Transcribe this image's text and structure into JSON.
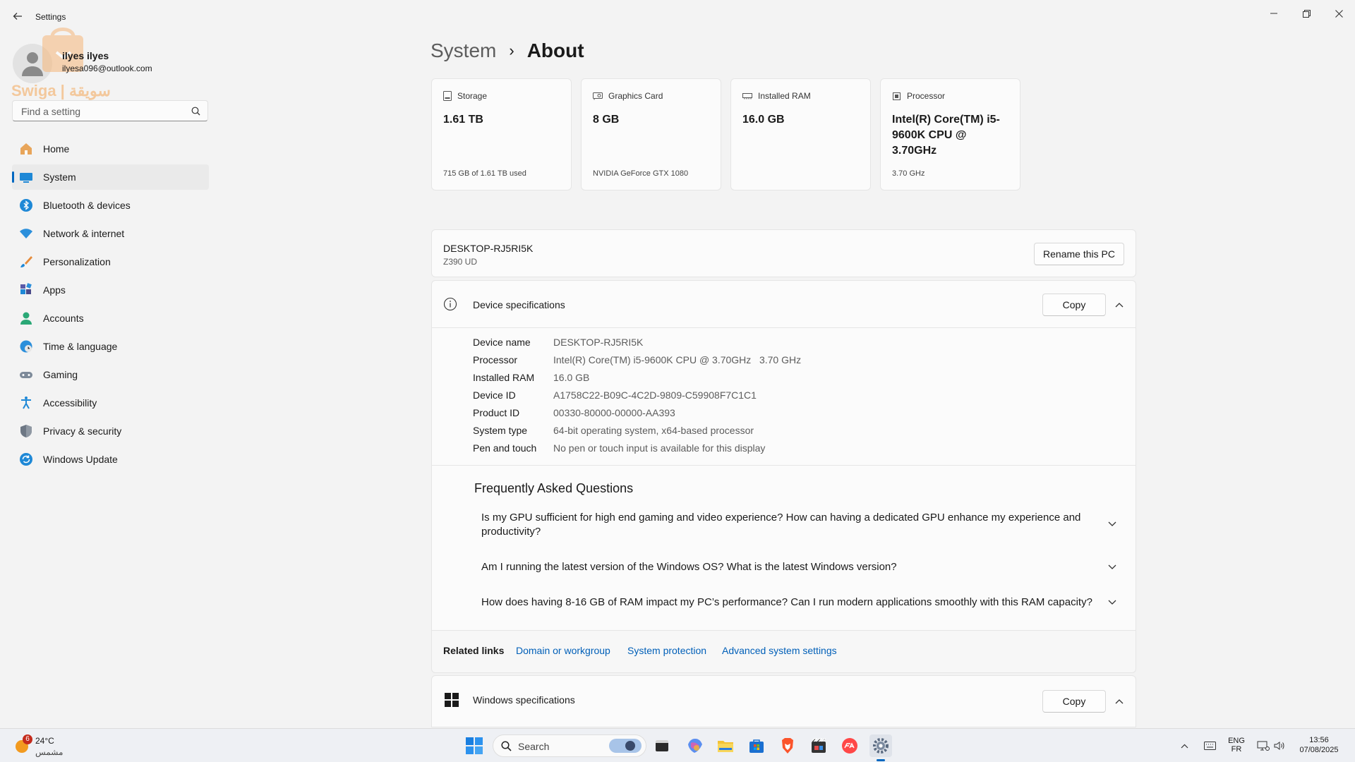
{
  "window": {
    "title": "Settings"
  },
  "profile": {
    "name": "ilyes ilyes",
    "email": "ilyesa096@outlook.com"
  },
  "watermark": {
    "text": "Swiga | سويقة"
  },
  "search": {
    "placeholder": "Find a setting"
  },
  "nav": [
    {
      "label": "Home",
      "icon": "home-icon",
      "active": false
    },
    {
      "label": "System",
      "icon": "system-icon",
      "active": true
    },
    {
      "label": "Bluetooth & devices",
      "icon": "bluetooth-icon",
      "active": false
    },
    {
      "label": "Network & internet",
      "icon": "wifi-icon",
      "active": false
    },
    {
      "label": "Personalization",
      "icon": "brush-icon",
      "active": false
    },
    {
      "label": "Apps",
      "icon": "apps-icon",
      "active": false
    },
    {
      "label": "Accounts",
      "icon": "accounts-icon",
      "active": false
    },
    {
      "label": "Time & language",
      "icon": "globe-clock-icon",
      "active": false
    },
    {
      "label": "Gaming",
      "icon": "gamepad-icon",
      "active": false
    },
    {
      "label": "Accessibility",
      "icon": "accessibility-icon",
      "active": false
    },
    {
      "label": "Privacy & security",
      "icon": "shield-icon",
      "active": false
    },
    {
      "label": "Windows Update",
      "icon": "update-icon",
      "active": false
    }
  ],
  "breadcrumb": {
    "parent": "System",
    "separator": "›",
    "current": "About"
  },
  "cards": [
    {
      "label": "Storage",
      "value": "1.61 TB",
      "sub": "715 GB of 1.61 TB used",
      "icon": "storage-icon"
    },
    {
      "label": "Graphics Card",
      "value": "8 GB",
      "sub": "NVIDIA GeForce GTX 1080",
      "icon": "graphics-card-icon"
    },
    {
      "label": "Installed RAM",
      "value": "16.0 GB",
      "sub": "",
      "icon": "ram-icon"
    },
    {
      "label": "Processor",
      "value": "Intel(R) Core(TM) i5-9600K CPU @ 3.70GHz",
      "sub": "3.70 GHz",
      "icon": "processor-icon"
    }
  ],
  "pc": {
    "name": "DESKTOP-RJ5RI5K",
    "model": "Z390 UD",
    "rename_label": "Rename this PC"
  },
  "device_specs": {
    "title": "Device specifications",
    "copy_label": "Copy",
    "rows": [
      {
        "key": "Device name",
        "value": "DESKTOP-RJ5RI5K"
      },
      {
        "key": "Processor",
        "value": "Intel(R) Core(TM) i5-9600K CPU @ 3.70GHz   3.70 GHz"
      },
      {
        "key": "Installed RAM",
        "value": "16.0 GB"
      },
      {
        "key": "Device ID",
        "value": "A1758C22-B09C-4C2D-9809-C59908F7C1C1"
      },
      {
        "key": "Product ID",
        "value": "00330-80000-00000-AA393"
      },
      {
        "key": "System type",
        "value": "64-bit operating system, x64-based processor"
      },
      {
        "key": "Pen and touch",
        "value": "No pen or touch input is available for this display"
      }
    ]
  },
  "faq": {
    "title": "Frequently Asked Questions",
    "questions": [
      "Is my GPU sufficient for high end gaming and video experience? How can having a dedicated GPU enhance my experience and productivity?",
      "Am I running the latest version of the Windows OS? What is the latest Windows version?",
      "How does having 8-16 GB of RAM impact my PC’s performance? Can I run modern applications smoothly with this RAM capacity?"
    ]
  },
  "related": {
    "label": "Related links",
    "links": [
      "Domain or workgroup",
      "System protection",
      "Advanced system settings"
    ]
  },
  "windows_specs": {
    "title": "Windows specifications",
    "copy_label": "Copy"
  },
  "taskbar": {
    "weather": {
      "temp": "24°C",
      "condition": "مشمس",
      "badge": "6"
    },
    "search_label": "Search",
    "lang": {
      "line1": "ENG",
      "line2": "FR"
    },
    "clock": {
      "time": "13:56",
      "date": "07/08/2025"
    }
  },
  "colors": {
    "accent": "#0067c0",
    "link": "#005fb8"
  }
}
